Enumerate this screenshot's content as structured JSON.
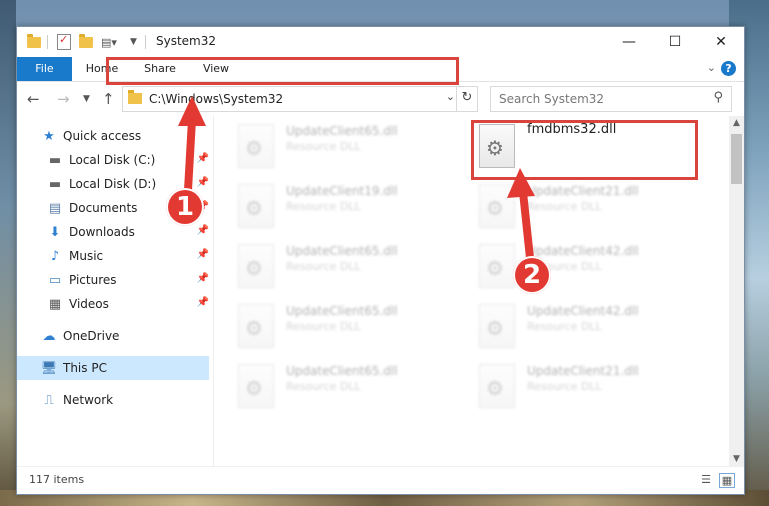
{
  "window": {
    "title": "System32",
    "controls": {
      "minimize": "—",
      "maximize": "☐",
      "close": "✕"
    }
  },
  "ribbon": {
    "tabs": [
      "File",
      "Home",
      "Share",
      "View"
    ],
    "help": "?"
  },
  "navbar": {
    "address": "C:\\Windows\\System32",
    "search_placeholder": "Search System32"
  },
  "sidebar": {
    "items": [
      {
        "label": "Quick access",
        "icon": "star-icon"
      },
      {
        "label": "Local Disk (C:)",
        "icon": "drive-icon",
        "pinned": true
      },
      {
        "label": "Local Disk (D:)",
        "icon": "drive-icon",
        "pinned": true
      },
      {
        "label": "Documents",
        "icon": "documents-icon",
        "pinned": true
      },
      {
        "label": "Downloads",
        "icon": "downloads-icon",
        "pinned": true
      },
      {
        "label": "Music",
        "icon": "music-icon",
        "pinned": true
      },
      {
        "label": "Pictures",
        "icon": "pictures-icon",
        "pinned": true
      },
      {
        "label": "Videos",
        "icon": "videos-icon",
        "pinned": true
      },
      {
        "label": "OneDrive",
        "icon": "cloud-icon"
      },
      {
        "label": "This PC",
        "icon": "computer-icon",
        "selected": true
      },
      {
        "label": "Network",
        "icon": "network-icon"
      }
    ]
  },
  "files": {
    "left_column": [
      {
        "name": "UpdateClient65.dll",
        "type": "Resource DLL"
      },
      {
        "name": "UpdateClient19.dll",
        "type": "Resource DLL"
      },
      {
        "name": "UpdateClient65.dll",
        "type": "Resource DLL"
      },
      {
        "name": "UpdateClient65.dll",
        "type": "Resource DLL"
      },
      {
        "name": "UpdateClient65.dll",
        "type": "Resource DLL"
      }
    ],
    "right_column": [
      {
        "name": "fmdbms32.dll",
        "type": ""
      },
      {
        "name": "UpdateClient21.dll",
        "type": "Resource DLL"
      },
      {
        "name": "UpdateClient42.dll",
        "type": "Resource DLL"
      },
      {
        "name": "UpdateClient42.dll",
        "type": "Resource DLL"
      },
      {
        "name": "UpdateClient21.dll",
        "type": "Resource DLL"
      }
    ]
  },
  "status": {
    "item_count": "117 items"
  },
  "annotations": {
    "step1": "1",
    "step2": "2",
    "color": "#e23a33"
  }
}
